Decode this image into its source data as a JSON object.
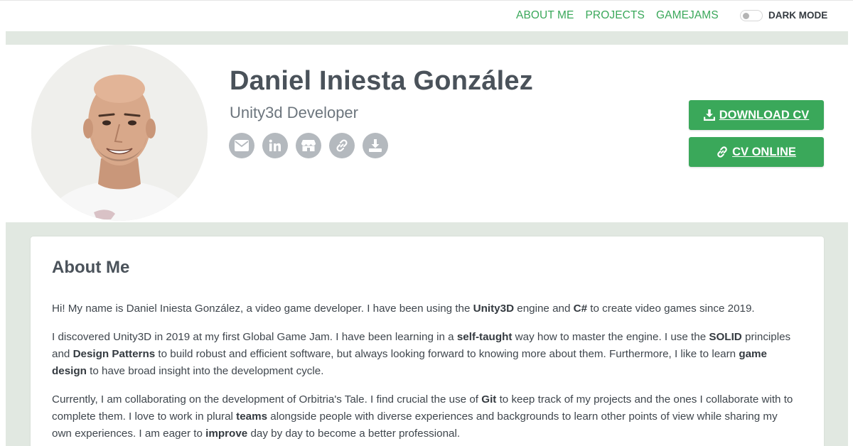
{
  "nav": {
    "items": [
      "ABOUT ME",
      "PROJECTS",
      "GAMEJAMS"
    ],
    "dark_mode_label": "DARK MODE"
  },
  "profile": {
    "name": "Daniel Iniesta González",
    "role": "Unity3d Developer",
    "social_icons": [
      "envelope-icon",
      "linkedin-icon",
      "itchio-icon",
      "link-icon",
      "download-icon"
    ]
  },
  "buttons": {
    "download_cv": "DOWNLOAD CV",
    "cv_online": "CV ONLINE"
  },
  "about": {
    "title": "About Me",
    "p1": [
      {
        "t": "Hi! My name is Daniel Iniesta González, a video game developer. I have been using the "
      },
      {
        "t": "Unity3D",
        "b": true
      },
      {
        "t": " engine and "
      },
      {
        "t": "C#",
        "b": true
      },
      {
        "t": " to create video games since 2019."
      }
    ],
    "p2": [
      {
        "t": "I discovered Unity3D in 2019 at my first Global Game Jam. I have been learning in a "
      },
      {
        "t": "self-taught",
        "b": true
      },
      {
        "t": " way how to master the engine. I use the "
      },
      {
        "t": "SOLID",
        "b": true
      },
      {
        "t": " principles and "
      },
      {
        "t": "Design Patterns",
        "b": true
      },
      {
        "t": " to build robust and efficient software, but always looking forward to knowing more about them. Furthermore, I like to learn "
      },
      {
        "t": "game design",
        "b": true
      },
      {
        "t": " to have broad insight into the development cycle."
      }
    ],
    "p3": [
      {
        "t": "Currently, I am collaborating on the development of Orbitria's Tale. I find crucial the use of "
      },
      {
        "t": "Git",
        "b": true
      },
      {
        "t": " to keep track of my projects and the ones I collaborate with to complete them. I love to work in plural "
      },
      {
        "t": "teams",
        "b": true
      },
      {
        "t": " alongside people with diverse experiences and backgrounds to learn other points of view while sharing my own experiences. I am eager to "
      },
      {
        "t": "improve",
        "b": true
      },
      {
        "t": " day by day to become a better professional."
      }
    ]
  },
  "colors": {
    "accent": "#3aa85a",
    "band": "#e1e8e1",
    "heading": "#4a525a",
    "icon_bg": "#b4b9be"
  }
}
